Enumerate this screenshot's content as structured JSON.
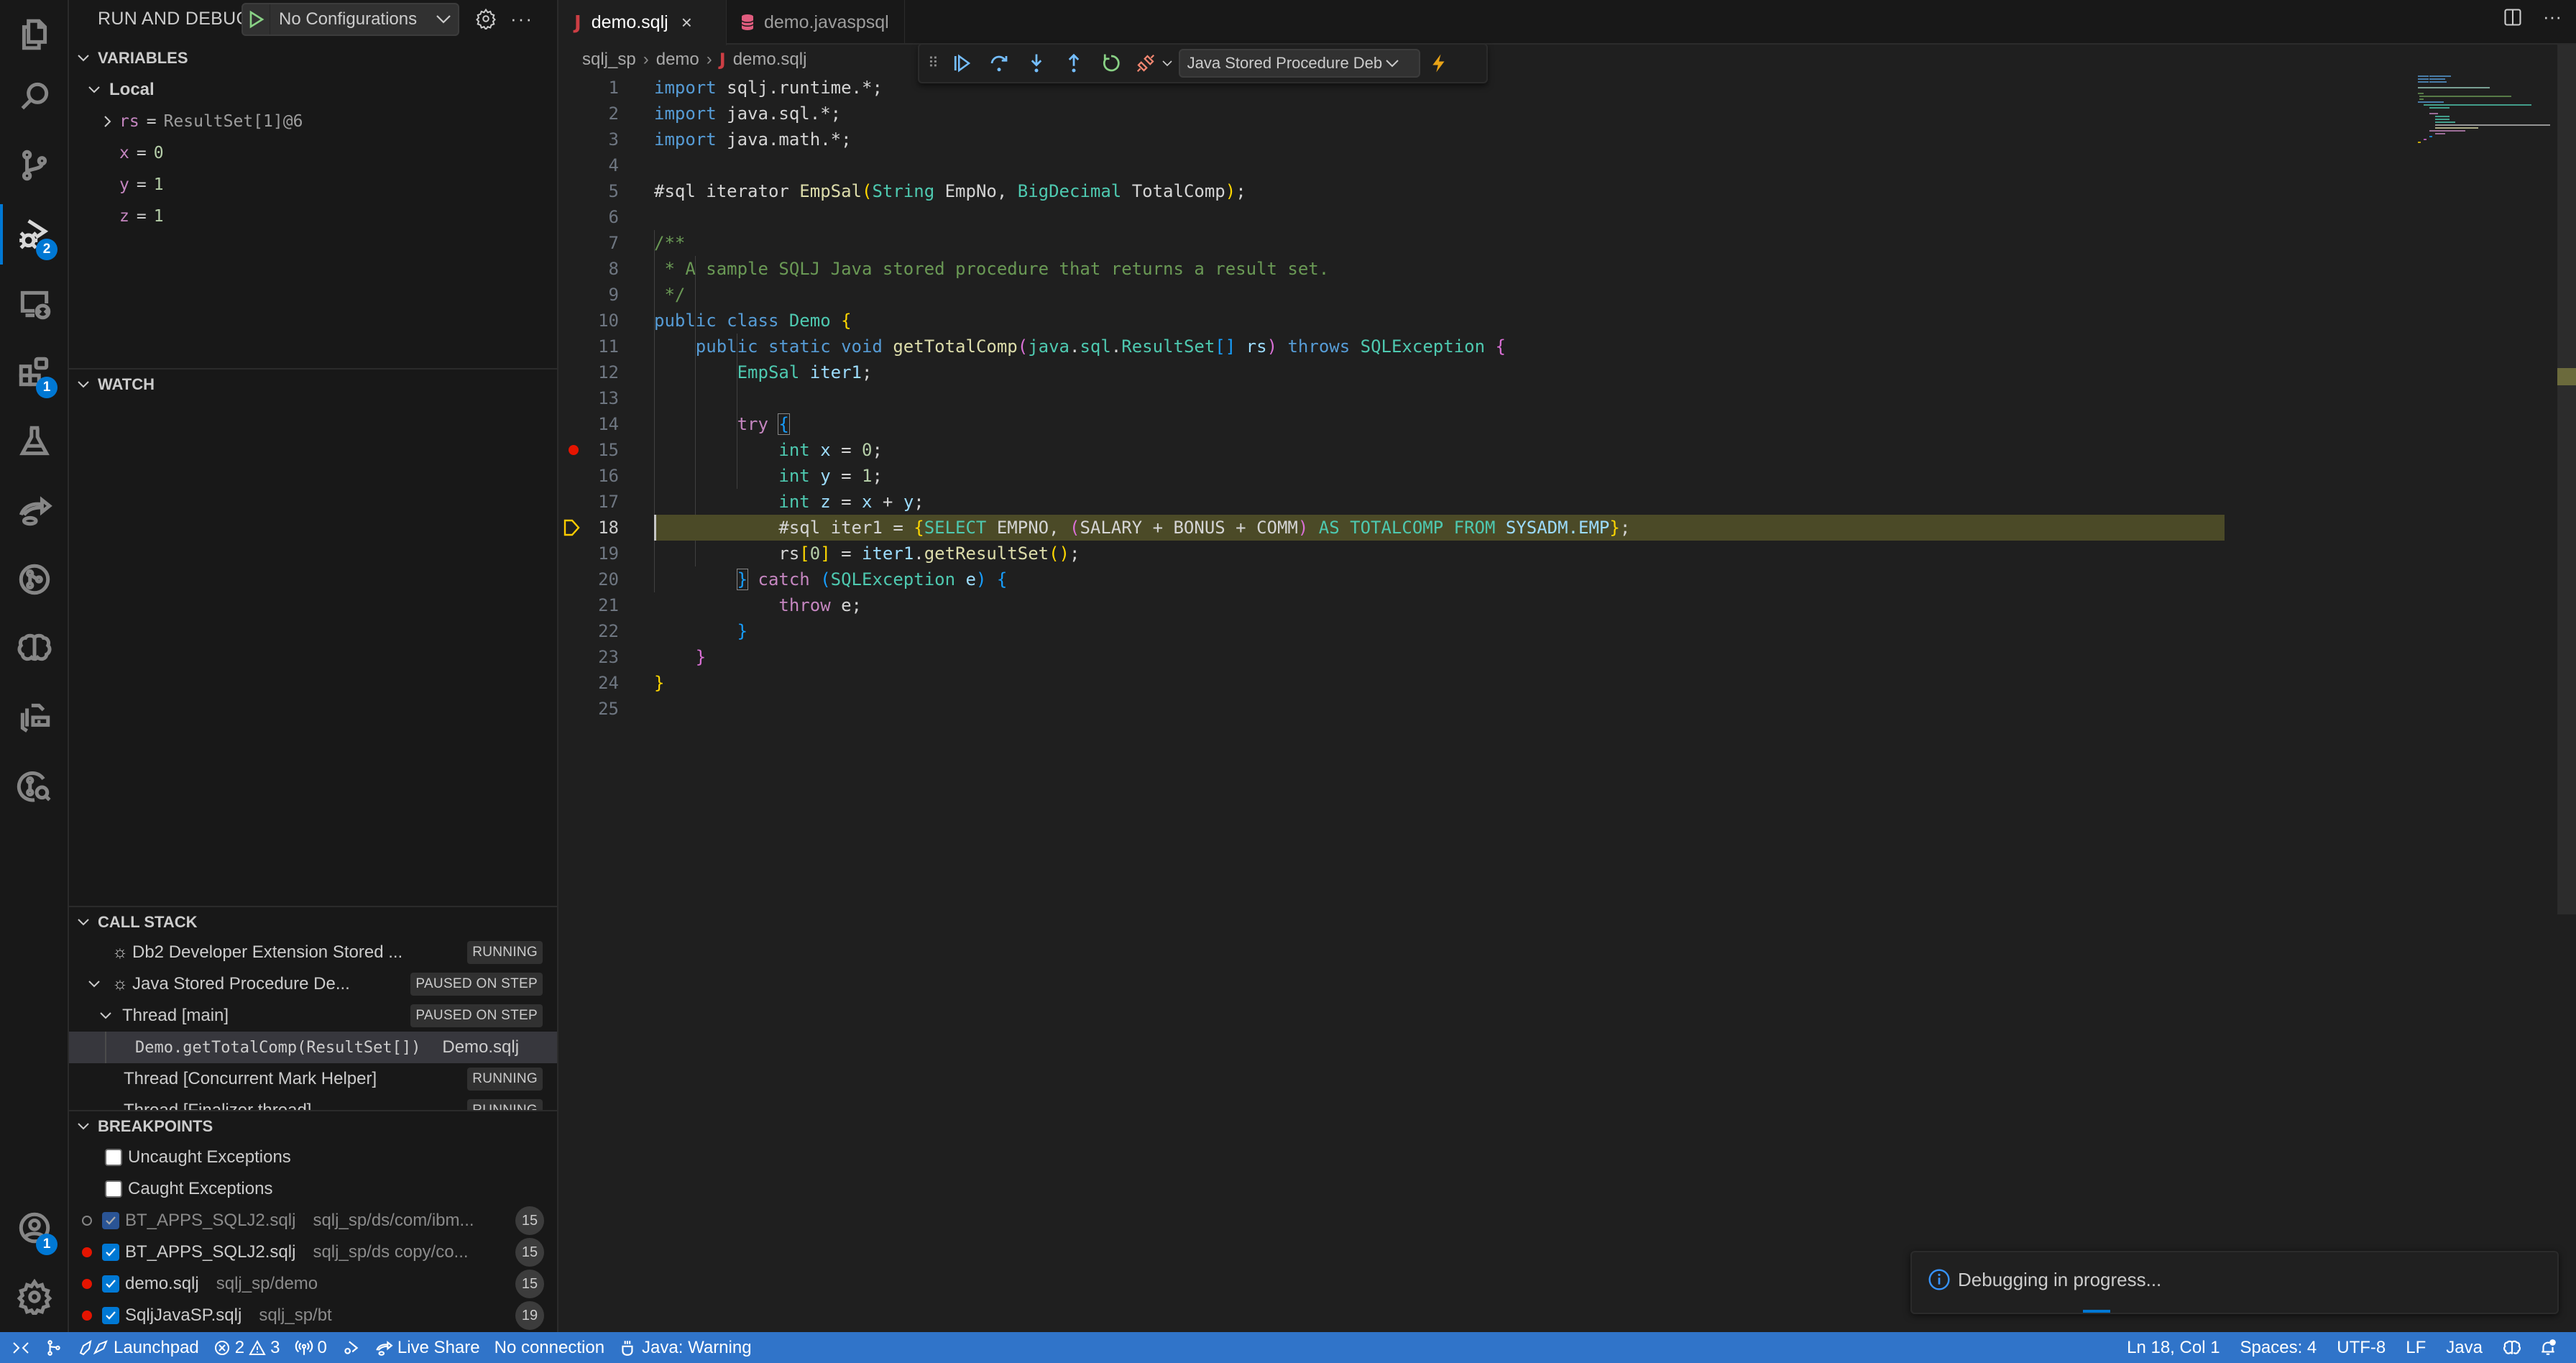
{
  "activity_bar": {
    "items": [
      {
        "name": "explorer",
        "icon": "files-icon"
      },
      {
        "name": "search",
        "icon": "search-icon"
      },
      {
        "name": "source-control",
        "icon": "source-control-icon"
      },
      {
        "name": "run-and-debug",
        "icon": "run-debug-icon",
        "badge": "2",
        "active": true
      },
      {
        "name": "remote-explorer",
        "icon": "remote-explorer-icon"
      },
      {
        "name": "extensions",
        "icon": "extensions-icon",
        "badge": "1"
      },
      {
        "name": "testing",
        "icon": "flask-icon"
      },
      {
        "name": "live-share",
        "icon": "live-share-icon"
      },
      {
        "name": "git-graph",
        "icon": "git-graph-icon"
      },
      {
        "name": "ai-assistant",
        "icon": "brain-icon"
      },
      {
        "name": "db2-explorer",
        "icon": "database-folder-icon"
      },
      {
        "name": "git-search",
        "icon": "git-search-icon"
      }
    ],
    "accounts_badge": "1"
  },
  "sidebar": {
    "title": "RUN AND DEBUG",
    "configuration": "No Configurations",
    "variables": {
      "header": "VARIABLES",
      "scope": "Local",
      "items": [
        {
          "name": "rs",
          "value": "ResultSet[1]@6",
          "expandable": true
        },
        {
          "name": "x",
          "value": "0"
        },
        {
          "name": "y",
          "value": "1"
        },
        {
          "name": "z",
          "value": "1"
        }
      ]
    },
    "watch": {
      "header": "WATCH"
    },
    "call_stack": {
      "header": "CALL STACK",
      "items": [
        {
          "label": "Db2 Developer Extension Stored ...",
          "status": "RUNNING"
        },
        {
          "label": "Java Stored Procedure De...",
          "status": "PAUSED ON STEP"
        },
        {
          "label": "Thread [main]",
          "status": "PAUSED ON STEP"
        },
        {
          "label": "Demo.getTotalComp(ResultSet[])",
          "file": "Demo.sqlj"
        },
        {
          "label": "Thread [Concurrent Mark Helper]",
          "status": "RUNNING"
        },
        {
          "label": "Thread [Finalizer thread]",
          "status": "RUNNING"
        }
      ]
    },
    "breakpoints": {
      "header": "BREAKPOINTS",
      "exceptions": [
        {
          "label": "Uncaught Exceptions",
          "checked": false
        },
        {
          "label": "Caught Exceptions",
          "checked": false
        }
      ],
      "items": [
        {
          "file": "BT_APPS_SQLJ2.sqlj",
          "path": "sqlj_sp/ds/com/ibm...",
          "line": "15",
          "enabled": true,
          "verified": false
        },
        {
          "file": "BT_APPS_SQLJ2.sqlj",
          "path": "sqlj_sp/ds copy/co...",
          "line": "15",
          "enabled": true,
          "verified": true
        },
        {
          "file": "demo.sqlj",
          "path": "sqlj_sp/demo",
          "line": "15",
          "enabled": true,
          "verified": true
        },
        {
          "file": "SqljJavaSP.sqlj",
          "path": "sqlj_sp/bt",
          "line": "19",
          "enabled": true,
          "verified": true
        }
      ]
    }
  },
  "editor": {
    "tabs": [
      {
        "label": "demo.sqlj",
        "icon": "java-icon",
        "active": true
      },
      {
        "label": "demo.javaspsql",
        "icon": "database-icon",
        "active": false
      }
    ],
    "breadcrumb": [
      "sqlj_sp",
      "demo",
      "demo.sqlj"
    ],
    "debug_toolbar": {
      "buttons": [
        "continue",
        "step-over",
        "step-into",
        "step-out",
        "restart",
        "disconnect"
      ],
      "session": "Java Stored Procedure Deb"
    },
    "current_line": 18,
    "breakpoint_lines": [
      15
    ]
  },
  "notification": {
    "message": "Debugging in progress..."
  },
  "statusbar": {
    "launchpad": "Launchpad",
    "errors": "2",
    "warnings": "3",
    "ports": "0",
    "live_share": "Live Share",
    "connection": "No connection",
    "java_status": "Java: Warning",
    "cursor": "Ln 18, Col 1",
    "indent": "Spaces: 4",
    "encoding": "UTF-8",
    "eol": "LF",
    "language": "Java"
  }
}
